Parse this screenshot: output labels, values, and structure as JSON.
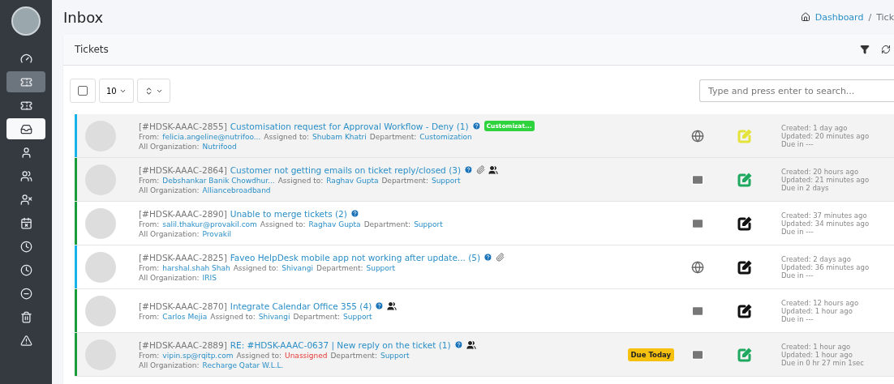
{
  "sidebar": {
    "items": [
      {
        "kind": "dashboard",
        "selected": false,
        "highlighted": false
      },
      {
        "kind": "ticket",
        "selected": false,
        "highlighted": true
      },
      {
        "kind": "ticket",
        "selected": false,
        "highlighted": false
      },
      {
        "kind": "inbox",
        "selected": true,
        "highlighted": false
      },
      {
        "kind": "user",
        "selected": false,
        "highlighted": false
      },
      {
        "kind": "users",
        "selected": false,
        "highlighted": false
      },
      {
        "kind": "user-x",
        "selected": false,
        "highlighted": false
      },
      {
        "kind": "calendar-x",
        "selected": false,
        "highlighted": false
      },
      {
        "kind": "clock",
        "selected": false,
        "highlighted": false
      },
      {
        "kind": "clock",
        "selected": false,
        "highlighted": false
      },
      {
        "kind": "minus",
        "selected": false,
        "highlighted": false
      },
      {
        "kind": "trash",
        "selected": false,
        "highlighted": false
      },
      {
        "kind": "warning",
        "selected": false,
        "highlighted": false
      }
    ]
  },
  "page": {
    "title": "Inbox",
    "breadcrumb": {
      "items": [
        "Dashboard",
        "Tick"
      ],
      "separator": "/"
    }
  },
  "card": {
    "title": "Tickets",
    "select_all_checked": false,
    "per_page": "10",
    "search": {
      "placeholder": "Type and press enter to search..."
    }
  },
  "tickets": [
    {
      "id": "[#HDSK-AAAC-2855]",
      "subject": "Customisation request for Approval Workflow - Deny (1)",
      "label": "Customizat...",
      "attachment": false,
      "collaborators": false,
      "from_label": "From:",
      "from": "felicia.angeline@nutrifoo...",
      "assigned_label": "Assigned to:",
      "assigned": "Shubam Khatri",
      "unassigned": false,
      "department_label": "Department:",
      "department": "Customization",
      "organization_label": "All Organization:",
      "organization": "Nutrifood",
      "kind": "web",
      "edit": {
        "color": "#e3e33a"
      },
      "color": "#17b3e8",
      "highlighted": true,
      "created": "Created: 1 day ago",
      "updated": "Updated: 20 minutes ago",
      "due": "Due in ---"
    },
    {
      "id": "[#HDSK-AAAC-2864]",
      "subject": "Customer not getting emails on ticket reply/closed (3)",
      "attachment": true,
      "collaborators": true,
      "from_label": "From:",
      "from": "Debshankar Banik Chowdhur...",
      "assigned_label": "Assigned to:",
      "assigned": "Raghav Gupta",
      "unassigned": false,
      "department_label": "Department:",
      "department": "Support",
      "organization_label": "All Organization:",
      "organization": "Alliancebroadband",
      "kind": "email",
      "edit": {
        "color": "#1fa860"
      },
      "color": "#1a9b3c",
      "highlighted": true,
      "created": "Created: 20 hours ago",
      "updated": "Updated: 21 minutes ago",
      "due": "Due in 2 days"
    },
    {
      "id": "[#HDSK-AAAC-2890]",
      "subject": "Unable to merge tickets (2)",
      "attachment": false,
      "collaborators": false,
      "from_label": "From:",
      "from": "salil.thakur@provakil.com",
      "assigned_label": "Assigned to:",
      "assigned": "Raghav Gupta",
      "unassigned": false,
      "department_label": "Department:",
      "department": "Support",
      "organization_label": "All Organization:",
      "organization": "Provakil",
      "kind": "email",
      "edit": {
        "color": "#111111"
      },
      "color": "#1a9b3c",
      "highlighted": false,
      "created": "Created: 37 minutes ago",
      "updated": "Updated: 34 minutes ago",
      "due": "Due in ---"
    },
    {
      "id": "[#HDSK-AAAC-2825]",
      "subject": "Faveo HelpDesk mobile app not working after update... (5)",
      "attachment": true,
      "collaborators": false,
      "from_label": "From:",
      "from": "harshal.shah Shah",
      "assigned_label": "Assigned to:",
      "assigned": "Shivangi",
      "unassigned": false,
      "department_label": "Department:",
      "department": "Support",
      "organization_label": "All Organization:",
      "organization": "IRIS",
      "kind": "web",
      "edit": {
        "color": "#111111"
      },
      "color": "#17b3e8",
      "highlighted": false,
      "created": "Created: 2 days ago",
      "updated": "Updated: 36 minutes ago",
      "due": "Due in ---"
    },
    {
      "id": "[#HDSK-AAAC-2870]",
      "subject": "Integrate Calendar Office 355 (4)",
      "attachment": false,
      "collaborators": true,
      "from_label": "From:",
      "from": "Carlos Mejia",
      "assigned_label": "Assigned to:",
      "assigned": "Shivangi",
      "unassigned": false,
      "department_label": "Department:",
      "department": "Support",
      "kind": "email",
      "edit": {
        "color": "#111111"
      },
      "color": "#1a9b3c",
      "highlighted": false,
      "created": "Created: 12 hours ago",
      "updated": "Updated: 1 hour ago",
      "due": "Due in ---"
    },
    {
      "id": "[#HDSK-AAAC-2889]",
      "subject": "RE: #HDSK-AAAC-0637 | New reply on the ticket (1)",
      "attachment": false,
      "collaborators": true,
      "from_label": "From:",
      "from": "vipin.sp@rqitp.com",
      "assigned_label": "Assigned to:",
      "assigned": "Unassigned",
      "unassigned": true,
      "department_label": "Department:",
      "department": "Support",
      "organization_label": "All Organization:",
      "organization": "Recharge Qatar W.L.L.",
      "due_badge": "Due Today",
      "kind": "email",
      "edit": {
        "color": "#1fa860"
      },
      "color": "#1a9b3c",
      "highlighted": true,
      "created": "Created: 1 hour ago",
      "updated": "Updated: 1 hour ago",
      "due": "Due in 0 hr 27 min 1sec"
    }
  ]
}
